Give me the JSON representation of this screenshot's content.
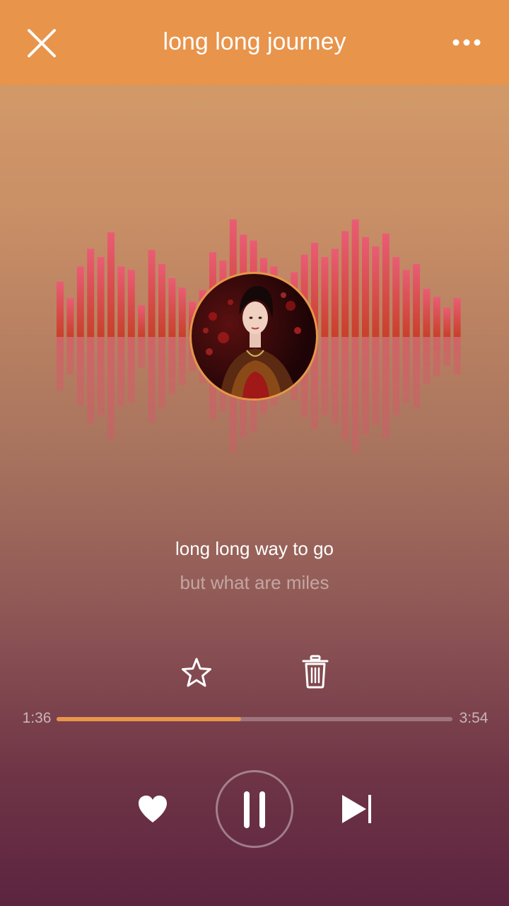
{
  "header": {
    "title": "long long journey"
  },
  "icons": {
    "close": "close-icon",
    "more": "more-icon",
    "favorite": "star-icon",
    "delete": "trash-icon",
    "like": "heart-icon",
    "pause": "pause-icon",
    "next": "skip-next-icon"
  },
  "lyrics": {
    "current": "long long way to go",
    "next": "but what are miles"
  },
  "playback": {
    "elapsed": "1:36",
    "total": "3:54",
    "progress": 0.466
  },
  "visualizer": {
    "levels": [
      0.47,
      0.33,
      0.6,
      0.75,
      0.68,
      0.89,
      0.6,
      0.57,
      0.27,
      0.74,
      0.62,
      0.5,
      0.42,
      0.3,
      0.4,
      0.72,
      0.65,
      1.0,
      0.87,
      0.82,
      0.67,
      0.6,
      0.45,
      0.55,
      0.7,
      0.8,
      0.68,
      0.75,
      0.9,
      1.0,
      0.85,
      0.77,
      0.88,
      0.68,
      0.57,
      0.62,
      0.41,
      0.34,
      0.25,
      0.33
    ]
  },
  "colors": {
    "accent": "#e8944b",
    "bar_top": "#e85a6e",
    "bar_bottom": "#c8402a"
  }
}
